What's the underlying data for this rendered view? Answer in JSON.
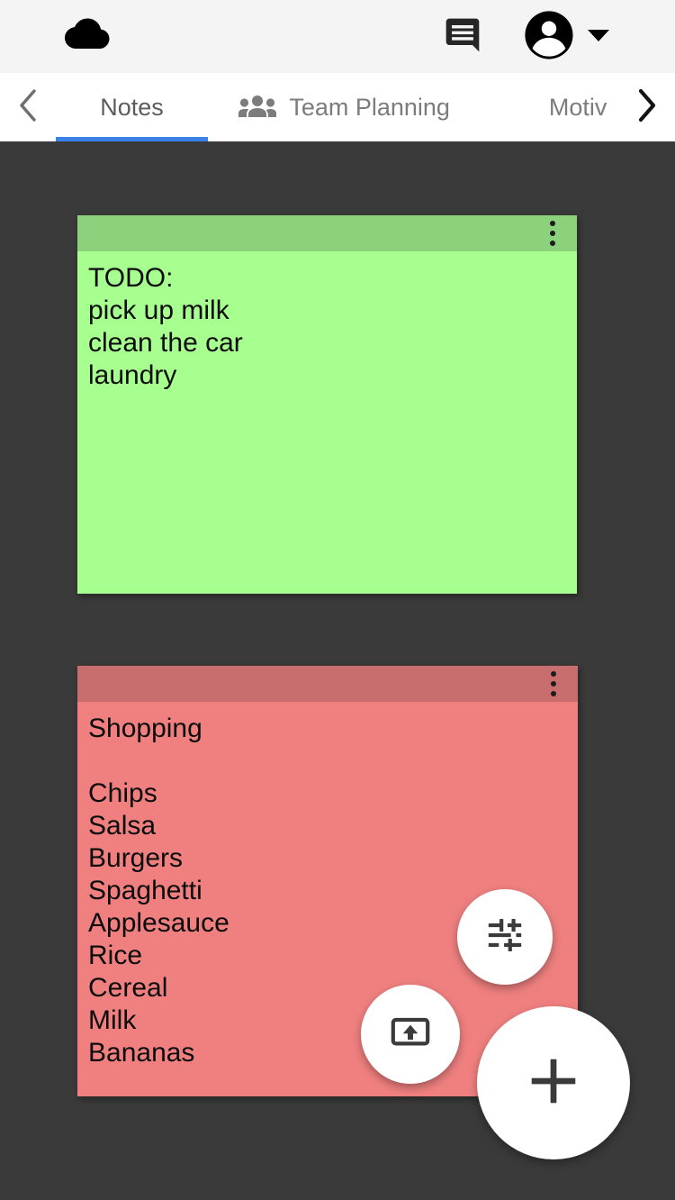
{
  "topbar": {
    "logo_icon": "cloud-icon",
    "comment_icon": "comment-icon",
    "account_icon": "account-circle-icon",
    "caret_icon": "caret-down-icon"
  },
  "tabbar": {
    "prev_icon": "chevron-left-icon",
    "next_icon": "chevron-right-icon",
    "active_index": 0,
    "accent_color": "#3b82e8",
    "tabs": [
      {
        "label": "Notes",
        "icon": null
      },
      {
        "label": "Team Planning",
        "icon": "people-group-icon"
      },
      {
        "label": "Motiv",
        "icon": null
      }
    ]
  },
  "canvas": {
    "background_color": "#3a3a3a",
    "notes": [
      {
        "title": "TODO note",
        "color": "#a6ff8f",
        "header_color": "#8cd17b",
        "menu_icon": "more-vert-icon",
        "text": "TODO:\npick up milk\nclean the car\nlaundry"
      },
      {
        "title": "Shopping note",
        "color": "#f08080",
        "header_color": "#c96e6e",
        "menu_icon": "more-vert-icon",
        "text": "Shopping\n\nChips\nSalsa\nBurgers\nSpaghetti\nApplesauce\nRice\nCereal\nMilk\nBananas"
      }
    ]
  },
  "fabs": {
    "tune": {
      "name": "tune-icon",
      "label": "Tune"
    },
    "upload": {
      "name": "present-to-all-icon",
      "label": "Upload"
    },
    "add": {
      "name": "plus-icon",
      "label": "Add"
    }
  }
}
